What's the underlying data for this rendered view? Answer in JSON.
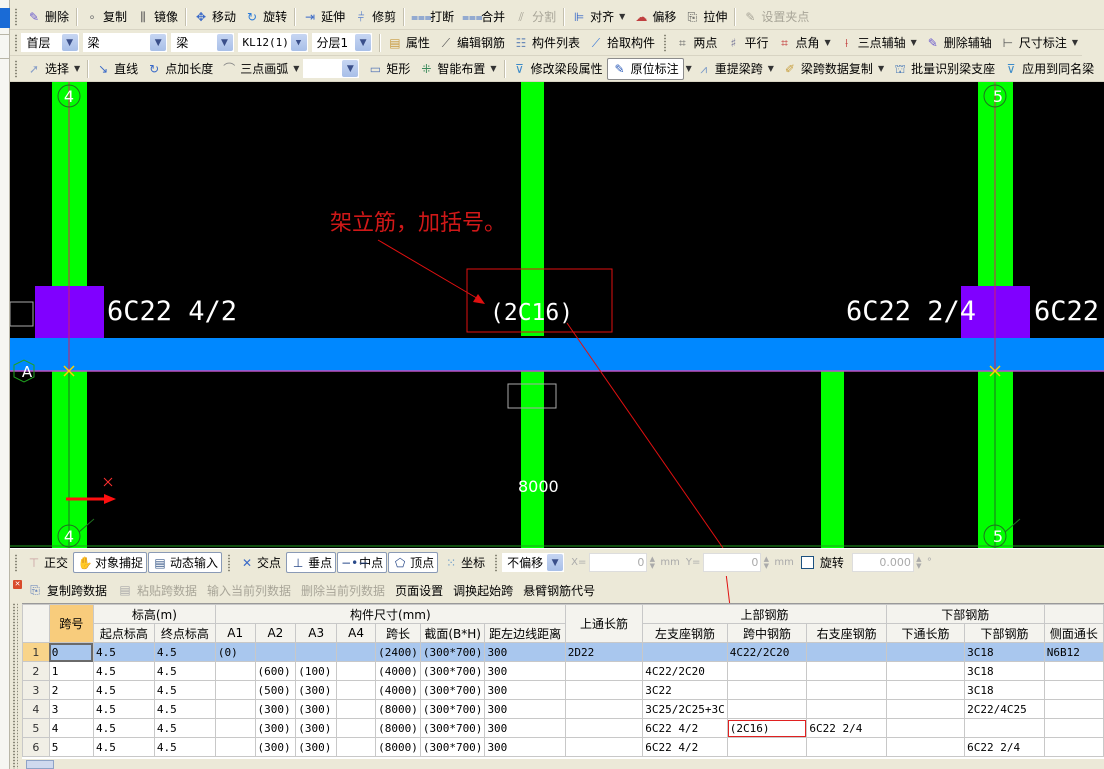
{
  "toolbar1": {
    "items": [
      {
        "label": "删除",
        "icon": "eraser-icon",
        "enabled": true
      },
      {
        "label": "复制",
        "icon": "copy-icon",
        "enabled": true
      },
      {
        "label": "镜像",
        "icon": "mirror-icon",
        "enabled": true
      },
      {
        "label": "移动",
        "icon": "move-icon",
        "enabled": true
      },
      {
        "label": "旋转",
        "icon": "rotate-icon",
        "enabled": true
      },
      {
        "label": "延伸",
        "icon": "extend-icon",
        "enabled": true
      },
      {
        "label": "修剪",
        "icon": "trim-icon",
        "enabled": true
      },
      {
        "label": "打断",
        "icon": "break-icon",
        "enabled": true
      },
      {
        "label": "合并",
        "icon": "merge-icon",
        "enabled": true
      },
      {
        "label": "分割",
        "icon": "split-icon",
        "enabled": false
      },
      {
        "label": "对齐",
        "icon": "align-icon",
        "enabled": true,
        "dropdown": true
      },
      {
        "label": "偏移",
        "icon": "offset-icon",
        "enabled": true
      },
      {
        "label": "拉伸",
        "icon": "stretch-icon",
        "enabled": true
      },
      {
        "label": "设置夹点",
        "icon": "grip-icon",
        "enabled": false
      }
    ]
  },
  "toolbar2": {
    "floor": "首层",
    "category": "梁",
    "type": "梁",
    "element": "KL12(1)",
    "layer": "分层1",
    "items": [
      {
        "label": "属性",
        "icon": "properties-icon"
      },
      {
        "label": "编辑钢筋",
        "icon": "edit-rebar-icon"
      },
      {
        "label": "构件列表",
        "icon": "list-icon"
      },
      {
        "label": "拾取构件",
        "icon": "eyedropper-icon"
      },
      {
        "label": "两点",
        "icon": "two-point-icon"
      },
      {
        "label": "平行",
        "icon": "parallel-icon"
      },
      {
        "label": "点角",
        "icon": "point-angle-icon",
        "dropdown": true
      },
      {
        "label": "三点辅轴",
        "icon": "three-point-axis-icon",
        "dropdown": true
      },
      {
        "label": "删除辅轴",
        "icon": "delete-axis-icon"
      },
      {
        "label": "尺寸标注",
        "icon": "dimension-icon",
        "dropdown": true
      }
    ]
  },
  "toolbar3": {
    "items": [
      {
        "label": "选择",
        "icon": "cursor-icon",
        "dropdown": true
      },
      {
        "label": "直线",
        "icon": "line-icon"
      },
      {
        "label": "点加长度",
        "icon": "point-length-icon"
      },
      {
        "label": "三点画弧",
        "icon": "arc-icon",
        "dropdown": true
      },
      {
        "label": "",
        "icon": "",
        "combo": true
      },
      {
        "label": "矩形",
        "icon": "rectangle-icon"
      },
      {
        "label": "智能布置",
        "icon": "smart-layout-icon",
        "dropdown": true
      },
      {
        "label": "修改梁段属性",
        "icon": "modify-beam-icon"
      },
      {
        "label": "原位标注",
        "icon": "in-situ-annotation-icon",
        "pressed": true,
        "dropdown": true
      },
      {
        "label": "重提梁跨",
        "icon": "re-span-icon",
        "dropdown": true
      },
      {
        "label": "梁跨数据复制",
        "icon": "copy-span-data-icon",
        "dropdown": true
      },
      {
        "label": "批量识别梁支座",
        "icon": "batch-support-icon"
      },
      {
        "label": "应用到同名梁",
        "icon": "apply-same-name-icon"
      }
    ]
  },
  "canvas": {
    "axis_labels": {
      "left_top": "4",
      "left_bottom": "4",
      "right_top": "5",
      "right_bottom": "5",
      "row": "A"
    },
    "annotations": {
      "left_support": "6C22 4/2",
      "mid_span": "(2C16)",
      "right_support_left": "6C22 2/4",
      "right_support_right": "6C22",
      "span_length": "8000",
      "note": "架立筋，加括号。"
    },
    "colors": {
      "background": "#000000",
      "column": "#00ff00",
      "beam": "#0080ff",
      "support": "#8000ff",
      "callout": "#e01010",
      "text": "#ffffff"
    }
  },
  "snapbar": {
    "ortho": "正交",
    "snap": "对象捕捉",
    "dynamic": "动态输入",
    "intersection": "交点",
    "perpendicular": "垂点",
    "midpoint": "中点",
    "vertex": "顶点",
    "coordinate": "坐标",
    "offset_mode": "不偏移",
    "x_label": "X=",
    "x_value": "0",
    "y_label": "Y=",
    "y_value": "0",
    "unit": "mm",
    "rotate_label": "旋转",
    "rotate_value": "0.000",
    "degree": "°"
  },
  "panel": {
    "buttons": [
      {
        "label": "复制跨数据",
        "enabled": true,
        "icon": "copy-data-icon"
      },
      {
        "label": "粘贴跨数据",
        "enabled": false,
        "icon": "paste-data-icon"
      },
      {
        "label": "输入当前列数据",
        "enabled": false
      },
      {
        "label": "删除当前列数据",
        "enabled": false
      },
      {
        "label": "页面设置",
        "enabled": true
      },
      {
        "label": "调换起始跨",
        "enabled": true
      },
      {
        "label": "悬臂钢筋代号",
        "enabled": true
      }
    ]
  },
  "grid": {
    "group_headers": {
      "span": "跨号",
      "elevation": "标高(m)",
      "dimensions": "构件尺寸(mm)",
      "top_through": "上通长筋",
      "top_rebar": "上部钢筋",
      "bottom_rebar": "下部钢筋"
    },
    "columns": [
      "起点标高",
      "终点标高",
      "A1",
      "A2",
      "A3",
      "A4",
      "跨长",
      "截面(B*H)",
      "距左边线距离",
      "左支座钢筋",
      "跨中钢筋",
      "右支座钢筋",
      "下通长筋",
      "下部钢筋",
      "侧面通长"
    ],
    "rows": [
      {
        "n": "1",
        "span": "0",
        "start": "4.5",
        "end": "4.5",
        "a1": "(0)",
        "a2": "",
        "a3": "",
        "a4": "",
        "len": "(2400)",
        "sec": "(300*700)",
        "dist": "300",
        "top_through": "2D22",
        "left": "",
        "mid": "4C22/2C20",
        "right": "",
        "bot_through": "",
        "bot": "3C18",
        "side": "N6B12"
      },
      {
        "n": "2",
        "span": "1",
        "start": "4.5",
        "end": "4.5",
        "a1": "",
        "a2": "(600)",
        "a3": "(100)",
        "a4": "",
        "len": "(4000)",
        "sec": "(300*700)",
        "dist": "300",
        "top_through": "",
        "left": "4C22/2C20",
        "mid": "",
        "right": "",
        "bot_through": "",
        "bot": "3C18",
        "side": ""
      },
      {
        "n": "3",
        "span": "2",
        "start": "4.5",
        "end": "4.5",
        "a1": "",
        "a2": "(500)",
        "a3": "(300)",
        "a4": "",
        "len": "(4000)",
        "sec": "(300*700)",
        "dist": "300",
        "top_through": "",
        "left": "3C22",
        "mid": "",
        "right": "",
        "bot_through": "",
        "bot": "3C18",
        "side": ""
      },
      {
        "n": "4",
        "span": "3",
        "start": "4.5",
        "end": "4.5",
        "a1": "",
        "a2": "(300)",
        "a3": "(300)",
        "a4": "",
        "len": "(8000)",
        "sec": "(300*700)",
        "dist": "300",
        "top_through": "",
        "left": "3C25/2C25+3C",
        "mid": "",
        "right": "",
        "bot_through": "",
        "bot": "2C22/4C25",
        "side": ""
      },
      {
        "n": "5",
        "span": "4",
        "start": "4.5",
        "end": "4.5",
        "a1": "",
        "a2": "(300)",
        "a3": "(300)",
        "a4": "",
        "len": "(8000)",
        "sec": "(300*700)",
        "dist": "300",
        "top_through": "",
        "left": "6C22 4/2",
        "mid": "(2C16)",
        "right": "6C22 2/4",
        "bot_through": "",
        "bot": "",
        "side": ""
      },
      {
        "n": "6",
        "span": "5",
        "start": "4.5",
        "end": "4.5",
        "a1": "",
        "a2": "(300)",
        "a3": "(300)",
        "a4": "",
        "len": "(8000)",
        "sec": "(300*700)",
        "dist": "300",
        "top_through": "",
        "left": "6C22 4/2",
        "mid": "",
        "right": "",
        "bot_through": "",
        "bot": "6C22 2/4",
        "side": ""
      }
    ]
  }
}
